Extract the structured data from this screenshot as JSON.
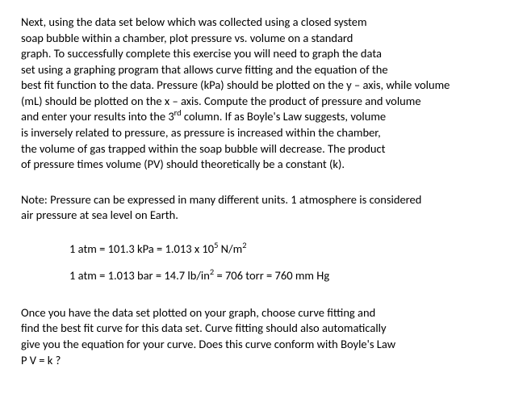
{
  "para1": {
    "l1": "Next,  using the data set below which was collected using a closed system",
    "l2": "soap bubble within a chamber,  plot pressure vs. volume on a standard",
    "l3": "graph. To successfully complete this exercise you will need to graph the data",
    "l4": "set using a graphing program that allows curve fitting and the equation of the",
    "l5": "best fit function to the data.   Pressure (kPa)  should be plotted on the y – axis, while volume",
    "l6": "(mL) should be plotted on the  x – axis.  Compute the product of pressure and volume",
    "l7a": "and enter your results into the 3",
    "l7sup": "rd",
    "l7b": " column.    If as Boyle's Law suggests, volume",
    "l8": "is inversely related to pressure, as pressure is increased within the chamber,",
    "l9": "the volume of gas trapped within the soap bubble will decrease.  The product",
    "l10": "of pressure times volume (PV)  should theoretically be a constant (k)."
  },
  "note": {
    "l1": "Note:   Pressure can be expressed in many different units.  1 atmosphere is considered",
    "l2": "air pressure at sea level on Earth."
  },
  "eq1": {
    "a": "1    atm  =  101.3  kPa  =  1.013 x 10",
    "sup": "5",
    "b": " N/m",
    "sup2": "2"
  },
  "eq2": {
    "a": "1 atm =  1.013 bar   =  14.7  lb/in",
    "sup": "2",
    "b": "  =  706 torr  =  760 mm Hg"
  },
  "para2": {
    "l1": "Once you have the data set plotted on your graph, choose curve fitting and",
    "l2": "find the  best fit curve for this data set.  Curve fitting should also automatically",
    "l3": "give you the equation for your curve.   Does this curve conform with Boyle's Law",
    "l4": "P V  = k    ?"
  }
}
